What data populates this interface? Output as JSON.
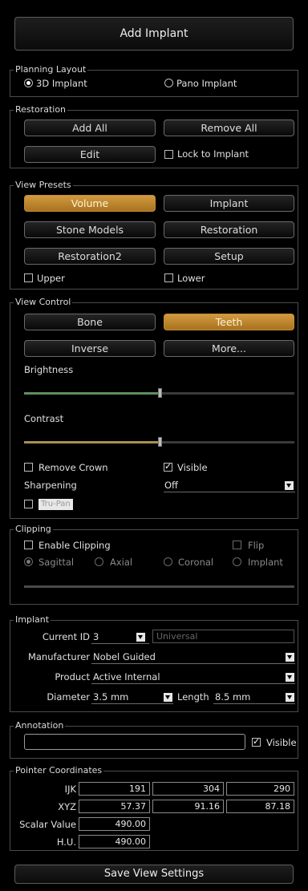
{
  "top_button": "Add Implant",
  "planning_layout": {
    "title": "Planning Layout",
    "opt_3d": "3D Implant",
    "opt_pano": "Pano Implant",
    "selected": "3D Implant"
  },
  "restoration": {
    "title": "Restoration",
    "add_all": "Add All",
    "remove_all": "Remove All",
    "edit": "Edit",
    "lock": "Lock to Implant"
  },
  "view_presets": {
    "title": "View Presets",
    "volume": "Volume",
    "implant": "Implant",
    "stone_models": "Stone Models",
    "restoration": "Restoration",
    "restoration2": "Restoration2",
    "setup": "Setup",
    "upper": "Upper",
    "lower": "Lower",
    "active": "Volume"
  },
  "view_control": {
    "title": "View Control",
    "bone": "Bone",
    "teeth": "Teeth",
    "inverse": "Inverse",
    "more": "More...",
    "brightness": "Brightness",
    "brightness_level": 0.5,
    "contrast": "Contrast",
    "contrast_level": 0.5,
    "remove_crown": "Remove Crown",
    "visible": "Visible",
    "sharpening": "Sharpening",
    "sharpening_value": "Off",
    "trupan": "Tru-Pan",
    "brightness_color": "#5d8f5d",
    "contrast_color": "#a89050",
    "active": "Teeth"
  },
  "clipping": {
    "title": "Clipping",
    "enable": "Enable Clipping",
    "flip": "Flip",
    "sagittal": "Sagittal",
    "axial": "Axial",
    "coronal": "Coronal",
    "implant": "Implant"
  },
  "implant": {
    "title": "Implant",
    "current_id_label": "Current ID",
    "current_id": "3",
    "universal": "Universal",
    "manufacturer_label": "Manufacturer",
    "manufacturer": "Nobel Guided",
    "product_label": "Product",
    "product": "Active Internal",
    "diameter_label": "Diameter",
    "diameter": "3.5 mm",
    "length_label": "Length",
    "length": "8.5 mm"
  },
  "annotation": {
    "title": "Annotation",
    "value": "",
    "visible": "Visible"
  },
  "pointer": {
    "title": "Pointer Coordinates",
    "ijk_label": "IJK",
    "ijk": [
      "191",
      "304",
      "290"
    ],
    "xyz_label": "XYZ",
    "xyz": [
      "57.37",
      "91.16",
      "87.18"
    ],
    "scalar_label": "Scalar Value",
    "scalar": "490.00",
    "hu_label": "H.U.",
    "hu": "490.00"
  },
  "bottom_button": "Save View Settings",
  "colors": {
    "accent": "#c08a36",
    "background": "#000000"
  }
}
